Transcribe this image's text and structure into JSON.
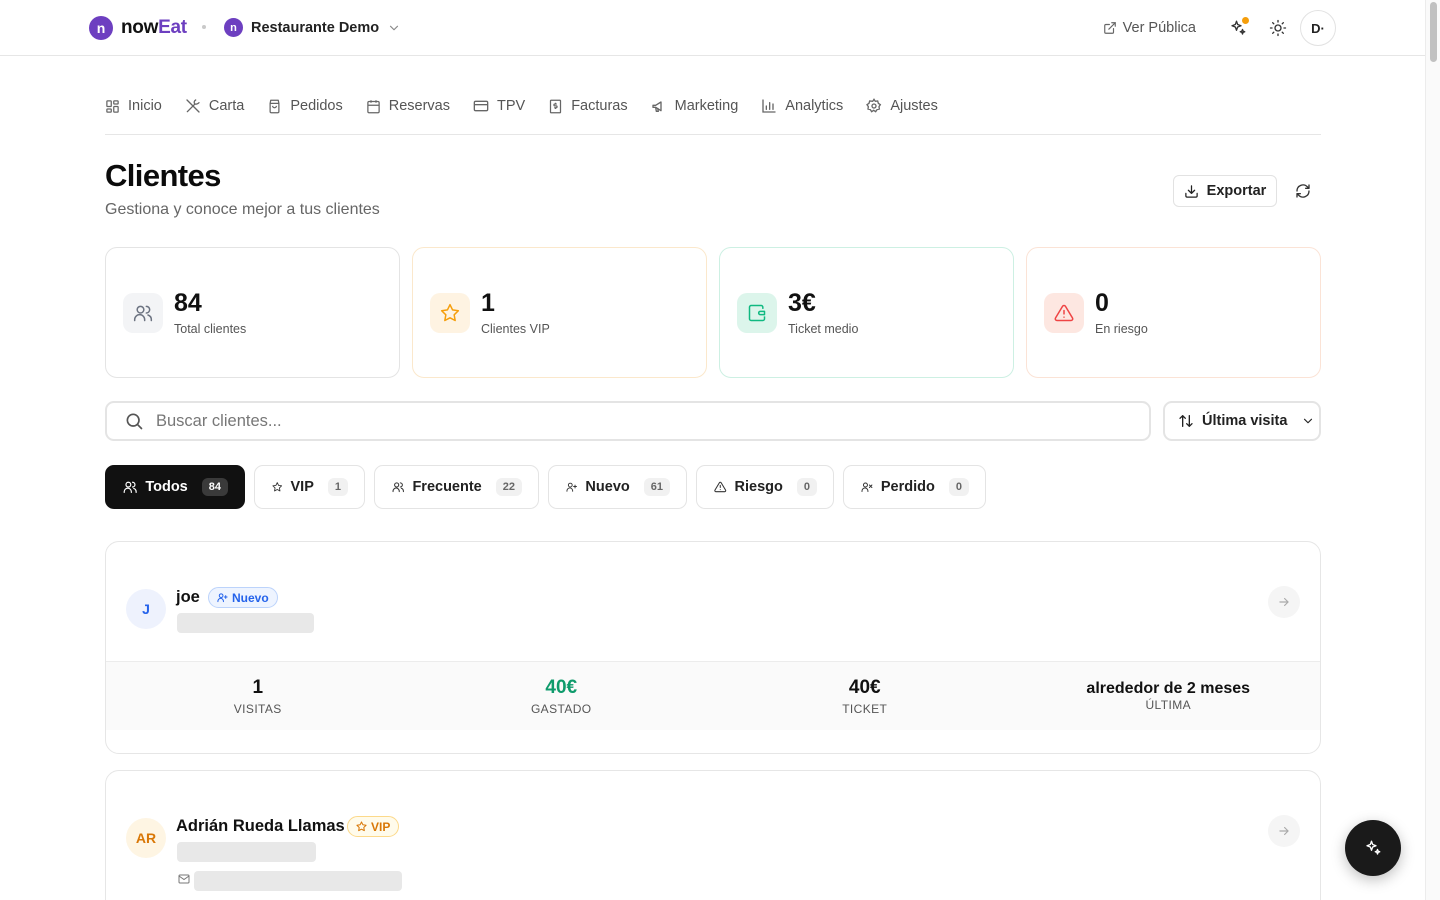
{
  "header": {
    "brand_prefix": "now",
    "brand_suffix": "Eat",
    "logo_letter": "n",
    "restaurant_name": "Restaurante Demo",
    "ver_publica": "Ver Pública",
    "user_initials": "D·"
  },
  "nav": {
    "items": [
      {
        "label": "Inicio",
        "icon": "grid-icon"
      },
      {
        "label": "Carta",
        "icon": "utensils-icon"
      },
      {
        "label": "Pedidos",
        "icon": "bag-icon"
      },
      {
        "label": "Reservas",
        "icon": "calendar-icon"
      },
      {
        "label": "TPV",
        "icon": "card-icon"
      },
      {
        "label": "Facturas",
        "icon": "receipt-icon"
      },
      {
        "label": "Marketing",
        "icon": "megaphone-icon"
      },
      {
        "label": "Analytics",
        "icon": "bar-chart-icon"
      },
      {
        "label": "Ajustes",
        "icon": "gear-icon"
      }
    ]
  },
  "page": {
    "title": "Clientes",
    "subtitle": "Gestiona y conoce mejor a tus clientes",
    "export_label": "Exportar"
  },
  "stats": [
    {
      "value": "84",
      "label": "Total clientes",
      "icon": "users-icon",
      "color": "#6b7280"
    },
    {
      "value": "1",
      "label": "Clientes VIP",
      "icon": "star-icon",
      "color": "#f59e0b"
    },
    {
      "value": "3€",
      "label": "Ticket medio",
      "icon": "wallet-icon",
      "color": "#10b981"
    },
    {
      "value": "0",
      "label": "En riesgo",
      "icon": "alert-triangle-icon",
      "color": "#ef4444"
    }
  ],
  "search": {
    "placeholder": "Buscar clientes...",
    "sort_label": "Última visita"
  },
  "filters": [
    {
      "label": "Todos",
      "count": "84",
      "active": true
    },
    {
      "label": "VIP",
      "count": "1"
    },
    {
      "label": "Frecuente",
      "count": "22"
    },
    {
      "label": "Nuevo",
      "count": "61"
    },
    {
      "label": "Riesgo",
      "count": "0"
    },
    {
      "label": "Perdido",
      "count": "0"
    }
  ],
  "clients": [
    {
      "initials": "J",
      "name": "joe",
      "badge": "Nuevo",
      "metrics": [
        {
          "value": "1",
          "label": "VISITAS"
        },
        {
          "value": "40€",
          "label": "GASTADO"
        },
        {
          "value": "40€",
          "label": "TICKET"
        },
        {
          "value": "alrededor de 2 meses",
          "label": "ÚLTIMA"
        }
      ]
    },
    {
      "initials": "AR",
      "name": "Adrián Rueda Llamas",
      "badge": "VIP"
    }
  ],
  "colors": {
    "brand": "#6d3fc0",
    "green": "#0f9b6c",
    "blue_badge": "#2563eb",
    "vip_badge": "#d97706"
  }
}
